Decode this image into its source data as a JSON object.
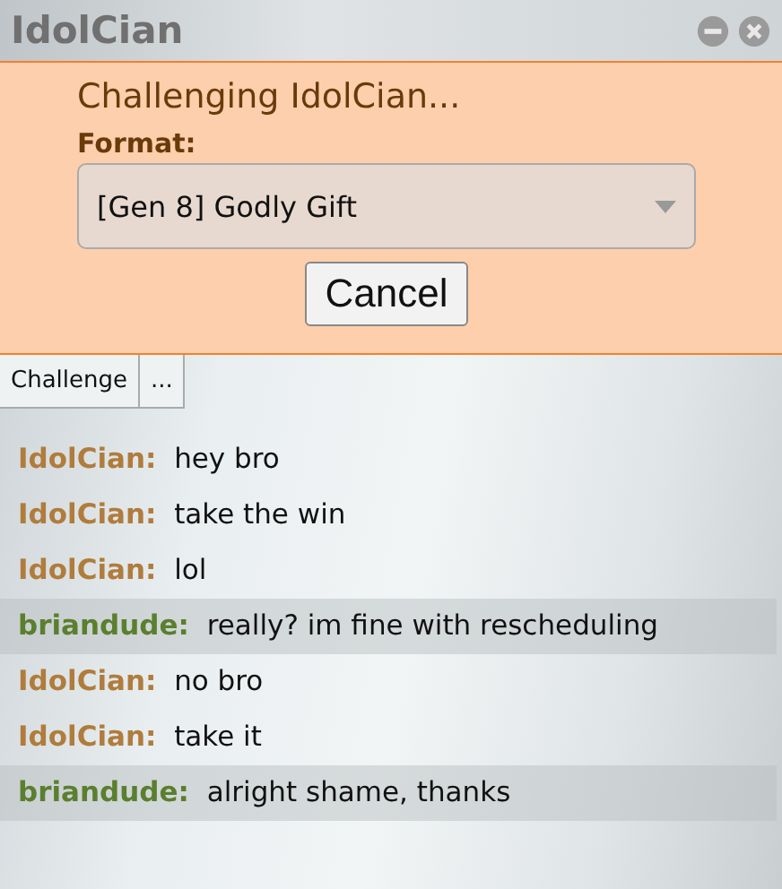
{
  "window": {
    "title": "IdolCian"
  },
  "challenge": {
    "heading": "Challenging IdolCian...",
    "format_label": "Format:",
    "format_value": "[Gen 8] Godly Gift",
    "cancel": "Cancel"
  },
  "tabs": [
    {
      "label": "Challenge"
    },
    {
      "label": "..."
    }
  ],
  "messages": [
    {
      "user": "IdolCian:",
      "text": "hey bro",
      "color": "#b07c3c",
      "highlighted": false
    },
    {
      "user": "IdolCian:",
      "text": "take the win",
      "color": "#b07c3c",
      "highlighted": false
    },
    {
      "user": "IdolCian:",
      "text": "lol",
      "color": "#b07c3c",
      "highlighted": false
    },
    {
      "user": "briandude:",
      "text": "really? im fine with rescheduling",
      "color": "#5a7f2e",
      "highlighted": true
    },
    {
      "user": "IdolCian:",
      "text": "no bro",
      "color": "#b07c3c",
      "highlighted": false
    },
    {
      "user": "IdolCian:",
      "text": "take it",
      "color": "#b07c3c",
      "highlighted": false
    },
    {
      "user": "briandude:",
      "text": "alright shame, thanks",
      "color": "#5a7f2e",
      "highlighted": true
    }
  ]
}
